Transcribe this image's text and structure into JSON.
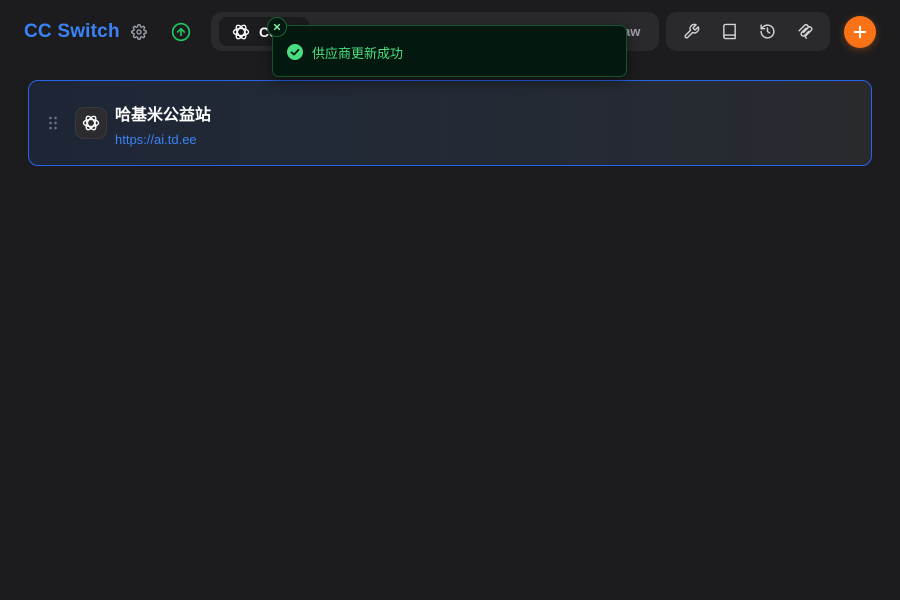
{
  "header": {
    "app_title": "CC Switch",
    "settings_icon": "gear-icon",
    "update_icon": "arrow-up-circle-icon"
  },
  "app_tabs": {
    "active_tab_label": "Codex",
    "active_tab_icon": "openai-icon",
    "last_tab_visible_label": "aw"
  },
  "tools": [
    {
      "name": "wrench-icon"
    },
    {
      "name": "book-icon"
    },
    {
      "name": "history-icon"
    },
    {
      "name": "mcp-icon"
    }
  ],
  "add_button": {
    "icon": "plus-icon"
  },
  "toast": {
    "message": "供应商更新成功",
    "status_icon": "check-circle-icon",
    "close_icon": "close-icon"
  },
  "providers": [
    {
      "name": "哈基米公益站",
      "url": "https://ai.td.ee",
      "icon": "openai-icon"
    }
  ],
  "colors": {
    "background": "#1c1c1e",
    "accent_blue": "#3b82f6",
    "add_orange": "#f97316",
    "toast_green": "#4ade80",
    "update_green": "#22c55e"
  }
}
